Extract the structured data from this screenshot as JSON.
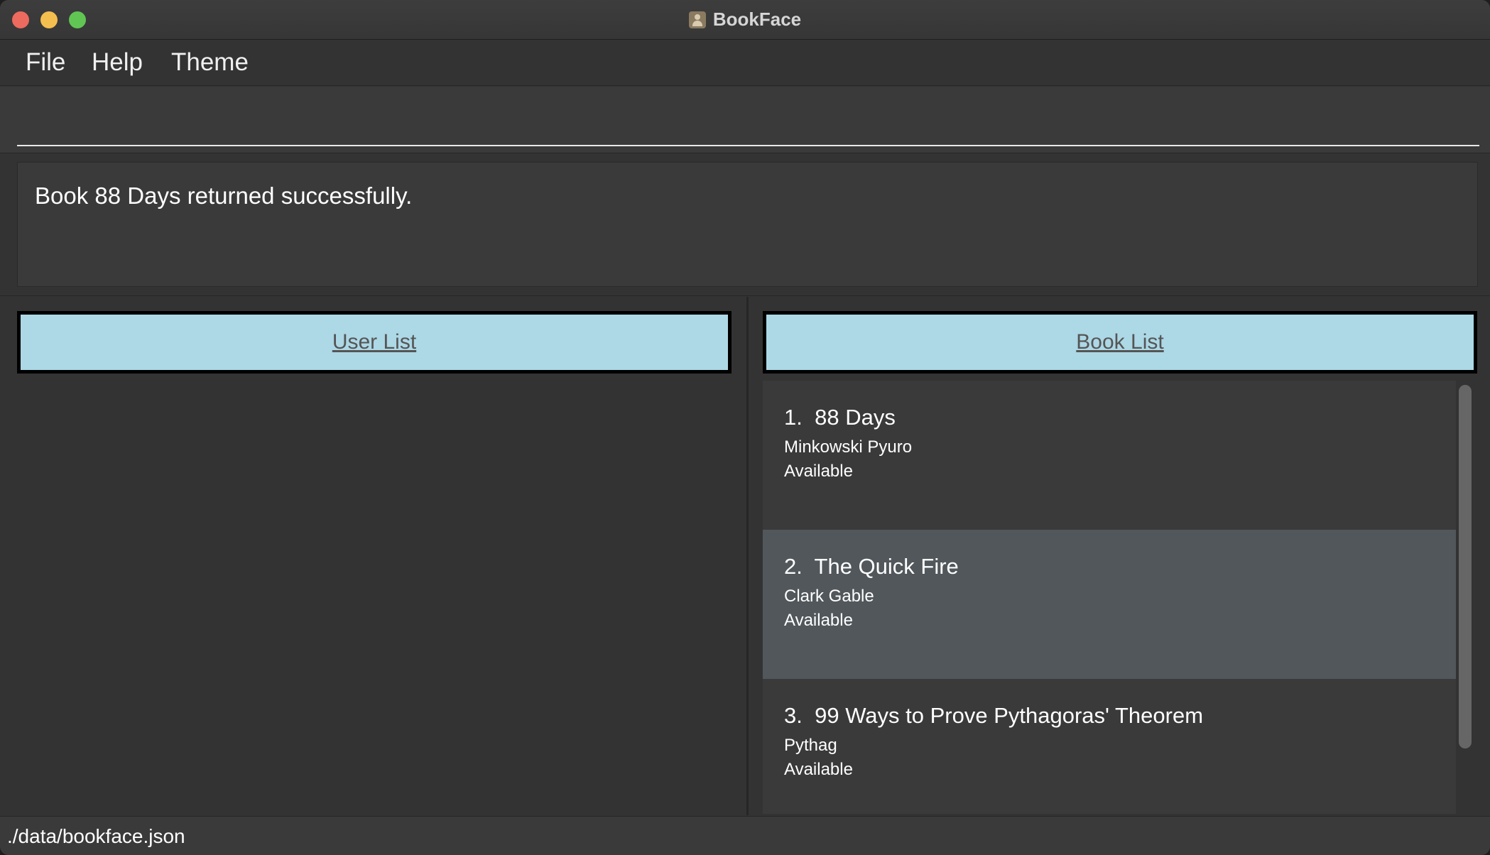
{
  "window": {
    "title": "BookFace",
    "icon": "app-person-icon"
  },
  "menu": {
    "items": [
      {
        "label": "File"
      },
      {
        "label": "Help"
      },
      {
        "label": "Theme"
      }
    ]
  },
  "command": {
    "value": "",
    "placeholder": ""
  },
  "result": {
    "message": "Book 88 Days returned successfully."
  },
  "user_list": {
    "header": "User List",
    "items": []
  },
  "book_list": {
    "header": "Book List",
    "selected_index": 1,
    "items": [
      {
        "index": "1.",
        "title": "88 Days",
        "author": "Minkowski Pyuro",
        "status": "Available"
      },
      {
        "index": "2.",
        "title": "The Quick Fire",
        "author": "Clark Gable",
        "status": "Available"
      },
      {
        "index": "3.",
        "title": "99 Ways to Prove Pythagoras' Theorem",
        "author": "Pythag",
        "status": "Available"
      }
    ]
  },
  "status_bar": {
    "path": "./data/bookface.json"
  },
  "colors": {
    "header_bg": "#add8e6",
    "selected_card": "#51575b",
    "background": "#333333"
  }
}
